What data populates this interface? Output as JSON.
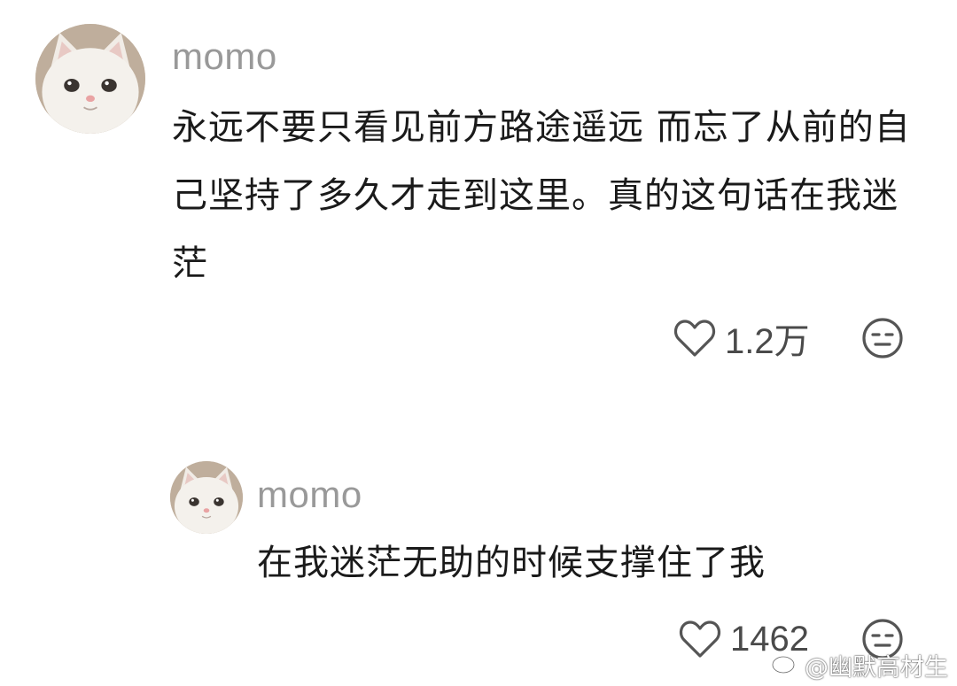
{
  "comments": [
    {
      "username": "momo",
      "text": "永远不要只看见前方路途遥远 而忘了从前的自己坚持了多久才走到这里。真的这句话在我迷茫",
      "like_count": "1.2万",
      "avatar_icon": "cat-avatar-icon",
      "like_icon": "heart-icon",
      "dislike_icon": "meh-face-icon"
    },
    {
      "username": "momo",
      "text": "在我迷茫无助的时候支撑住了我",
      "like_count": "1462",
      "avatar_icon": "cat-avatar-icon",
      "like_icon": "heart-icon",
      "dislike_icon": "meh-face-icon"
    }
  ],
  "watermark": {
    "text": "@幽默高材生",
    "logo_icon": "weibo-logo-icon"
  },
  "colors": {
    "background": "#ffffff",
    "username": "#999999",
    "text": "#1a1a1a",
    "icon": "#555555"
  }
}
